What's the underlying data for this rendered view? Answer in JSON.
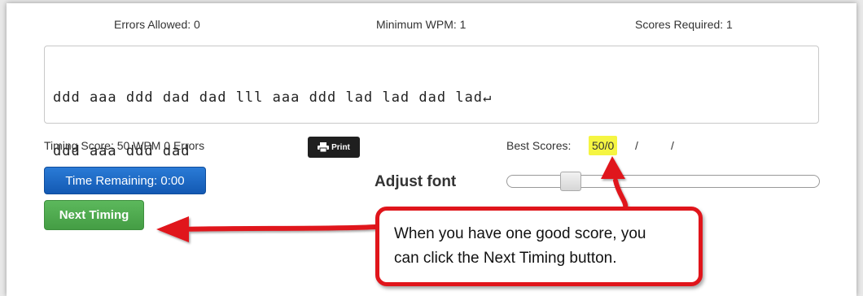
{
  "stats": {
    "errors_allowed": "Errors Allowed: 0",
    "minimum_wpm": "Minimum WPM: 1",
    "scores_required": "Scores Required: 1"
  },
  "passage": {
    "line1": "ddd aaa ddd dad dad lll aaa ddd lad lad dad lad↵",
    "line2": "ddd aaa ddd dad"
  },
  "results": {
    "timing_score": "Timing Score: 50 WPM 0 Errors",
    "print_label": "Print",
    "best_scores_label": "Best Scores:",
    "best_score_1": "50/0",
    "separator": "/"
  },
  "controls": {
    "time_remaining": "Time Remaining: 0:00",
    "next_timing": "Next Timing",
    "adjust_font": "Adjust font",
    "font_slider_value": 0.2
  },
  "callout": {
    "line1": "When you have one good score, you",
    "line2": "can click the Next Timing button."
  },
  "colors": {
    "time_button": "#1a6ac4",
    "next_button": "#4cae4c",
    "highlight": "#f5f542",
    "arrow": "#e0151b"
  }
}
